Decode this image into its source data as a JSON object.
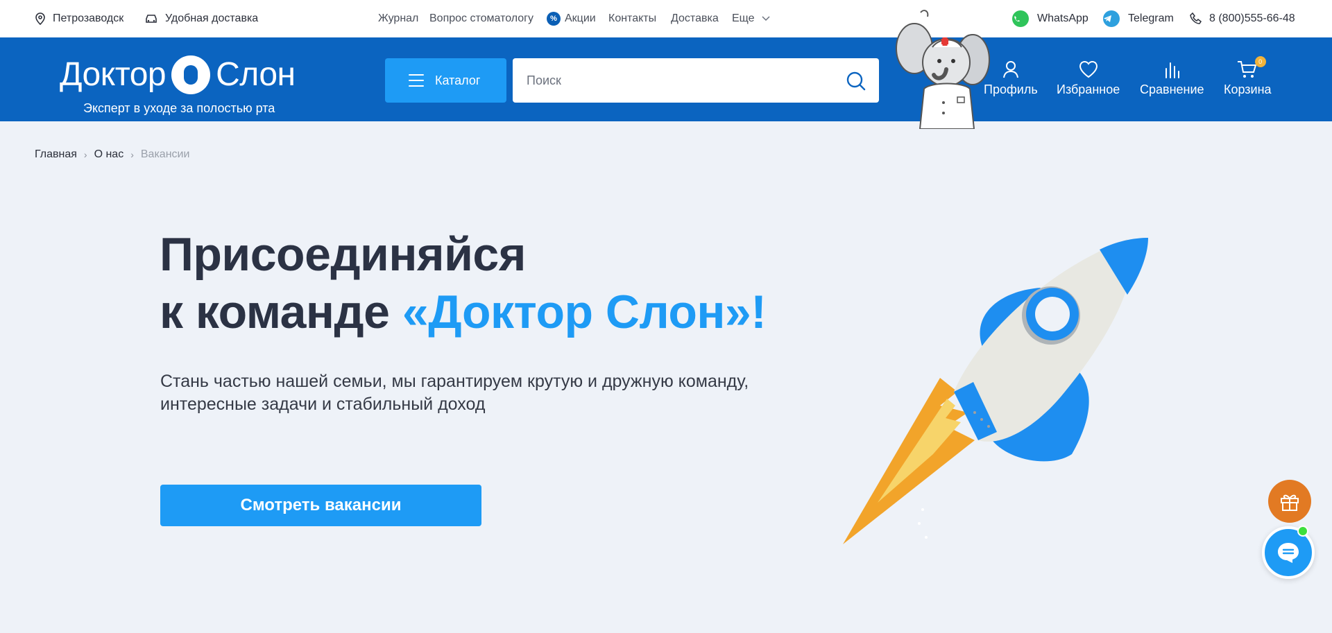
{
  "topbar": {
    "city": "Петрозаводск",
    "delivery": "Удобная доставка",
    "nav": [
      "Журнал",
      "Вопрос стоматологу",
      "Акции",
      "Контакты",
      "Доставка",
      "Еще"
    ],
    "promo_badge": "%",
    "whatsapp": "WhatsApp",
    "telegram": "Telegram",
    "phone": "8 (800)555-66-48"
  },
  "header": {
    "logo_left": "Доктор",
    "logo_right": "Слон",
    "logo_sub": "Эксперт в уходе за полостью рта",
    "catalog": "Каталог",
    "search_placeholder": "Поиск",
    "actions": {
      "profile": "Профиль",
      "favorites": "Избранное",
      "compare": "Сравнение",
      "cart": "Корзина"
    },
    "cart_count": "0"
  },
  "breadcrumb": [
    "Главная",
    "О нас",
    "Вакансии"
  ],
  "hero": {
    "title_line1": "Присоединяйся",
    "title_line2_prefix": "к команде ",
    "title_line2_accent": "«Доктор Слон»!",
    "desc_line1": "Стань частью нашей семьи, мы гарантируем крутую и дружную команду,",
    "desc_line2": "интересные задачи и стабильный доход",
    "cta": "Смотреть вакансии"
  },
  "colors": {
    "header_blue": "#0b64c0",
    "accent_blue": "#1e9bf5",
    "background": "#eef2f8",
    "gift_orange": "#e27a23",
    "online_green": "#3ddf3d"
  }
}
